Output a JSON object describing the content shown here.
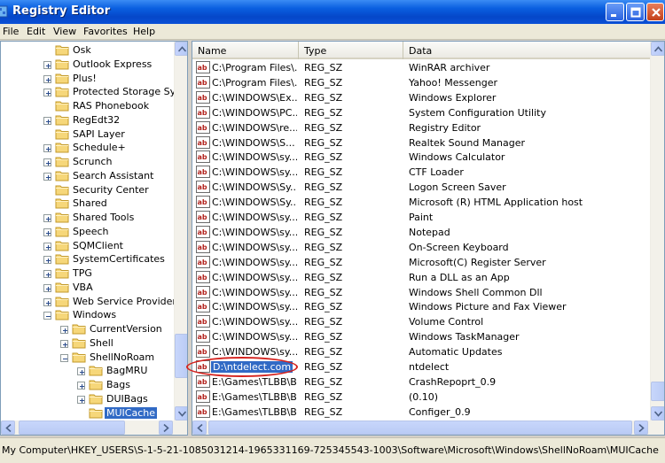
{
  "window": {
    "title": "Registry Editor"
  },
  "menu": [
    "File",
    "Edit",
    "View",
    "Favorites",
    "Help"
  ],
  "tree": {
    "items": [
      {
        "label": "Osk",
        "expander": "none"
      },
      {
        "label": "Outlook Express",
        "expander": "plus"
      },
      {
        "label": "Plus!",
        "expander": "plus"
      },
      {
        "label": "Protected Storage Syst",
        "expander": "plus"
      },
      {
        "label": "RAS Phonebook",
        "expander": "none"
      },
      {
        "label": "RegEdt32",
        "expander": "plus"
      },
      {
        "label": "SAPI Layer",
        "expander": "none"
      },
      {
        "label": "Schedule+",
        "expander": "plus"
      },
      {
        "label": "Scrunch",
        "expander": "plus"
      },
      {
        "label": "Search Assistant",
        "expander": "plus"
      },
      {
        "label": "Security Center",
        "expander": "none"
      },
      {
        "label": "Shared",
        "expander": "none"
      },
      {
        "label": "Shared Tools",
        "expander": "plus"
      },
      {
        "label": "Speech",
        "expander": "plus"
      },
      {
        "label": "SQMClient",
        "expander": "plus"
      },
      {
        "label": "SystemCertificates",
        "expander": "plus"
      },
      {
        "label": "TPG",
        "expander": "plus"
      },
      {
        "label": "VBA",
        "expander": "plus"
      },
      {
        "label": "Web Service Providers",
        "expander": "plus"
      },
      {
        "label": "Windows",
        "expander": "minus"
      },
      {
        "label": "CurrentVersion",
        "expander": "plus"
      },
      {
        "label": "Shell",
        "expander": "plus"
      },
      {
        "label": "ShellNoRoam",
        "expander": "minus"
      },
      {
        "label": "BagMRU",
        "expander": "plus"
      },
      {
        "label": "Bags",
        "expander": "plus"
      },
      {
        "label": "DUIBags",
        "expander": "plus"
      },
      {
        "label": "MUICache",
        "expander": "none",
        "selected": true
      }
    ]
  },
  "list": {
    "columns": {
      "name": "Name",
      "type": "Type",
      "data": "Data"
    },
    "rows": [
      {
        "name": "C:\\Program Files\\...",
        "type": "REG_SZ",
        "data": "WinRAR archiver"
      },
      {
        "name": "C:\\Program Files\\...",
        "type": "REG_SZ",
        "data": "Yahoo! Messenger"
      },
      {
        "name": "C:\\WINDOWS\\Ex...",
        "type": "REG_SZ",
        "data": "Windows Explorer"
      },
      {
        "name": "C:\\WINDOWS\\PC...",
        "type": "REG_SZ",
        "data": "System Configuration Utility"
      },
      {
        "name": "C:\\WINDOWS\\re...",
        "type": "REG_SZ",
        "data": "Registry Editor"
      },
      {
        "name": "C:\\WINDOWS\\S...",
        "type": "REG_SZ",
        "data": "Realtek Sound Manager"
      },
      {
        "name": "C:\\WINDOWS\\sy...",
        "type": "REG_SZ",
        "data": "Windows Calculator"
      },
      {
        "name": "C:\\WINDOWS\\sy...",
        "type": "REG_SZ",
        "data": "CTF Loader"
      },
      {
        "name": "C:\\WINDOWS\\Sy...",
        "type": "REG_SZ",
        "data": "Logon Screen Saver"
      },
      {
        "name": "C:\\WINDOWS\\Sy...",
        "type": "REG_SZ",
        "data": "Microsoft (R) HTML Application host"
      },
      {
        "name": "C:\\WINDOWS\\sy...",
        "type": "REG_SZ",
        "data": "Paint"
      },
      {
        "name": "C:\\WINDOWS\\sy...",
        "type": "REG_SZ",
        "data": "Notepad"
      },
      {
        "name": "C:\\WINDOWS\\sy...",
        "type": "REG_SZ",
        "data": "On-Screen Keyboard"
      },
      {
        "name": "C:\\WINDOWS\\sy...",
        "type": "REG_SZ",
        "data": "Microsoft(C) Register Server"
      },
      {
        "name": "C:\\WINDOWS\\sy...",
        "type": "REG_SZ",
        "data": "Run a DLL as an App"
      },
      {
        "name": "C:\\WINDOWS\\sy...",
        "type": "REG_SZ",
        "data": "Windows Shell Common Dll"
      },
      {
        "name": "C:\\WINDOWS\\sy...",
        "type": "REG_SZ",
        "data": "Windows Picture and Fax Viewer"
      },
      {
        "name": "C:\\WINDOWS\\sy...",
        "type": "REG_SZ",
        "data": "Volume Control"
      },
      {
        "name": "C:\\WINDOWS\\sy...",
        "type": "REG_SZ",
        "data": "Windows TaskManager"
      },
      {
        "name": "C:\\WINDOWS\\sy...",
        "type": "REG_SZ",
        "data": "Automatic Updates"
      },
      {
        "name": "D:\\ntdelect.com",
        "type": "REG_SZ",
        "data": "ntdelect",
        "selected": true
      },
      {
        "name": "E:\\Games\\TLBB\\B...",
        "type": "REG_SZ",
        "data": "CrashRepoprt_0.9"
      },
      {
        "name": "E:\\Games\\TLBB\\B...",
        "type": "REG_SZ",
        "data": "(0.10)"
      },
      {
        "name": "E:\\Games\\TLBB\\B...",
        "type": "REG_SZ",
        "data": "Configer_0.9"
      }
    ]
  },
  "status": {
    "path": "My Computer\\HKEY_USERS\\S-1-5-21-1085031214-1965331169-725345543-1003\\Software\\Microsoft\\Windows\\ShellNoRoam\\MUICache"
  },
  "colors": {
    "titlebar": "#0a5fe0",
    "selection": "#316ac5",
    "highlight_ring": "#d4231f"
  },
  "icons": {
    "folder": "folder-icon",
    "reg_value": "reg-sz-icon",
    "app": "registry-editor-icon"
  }
}
